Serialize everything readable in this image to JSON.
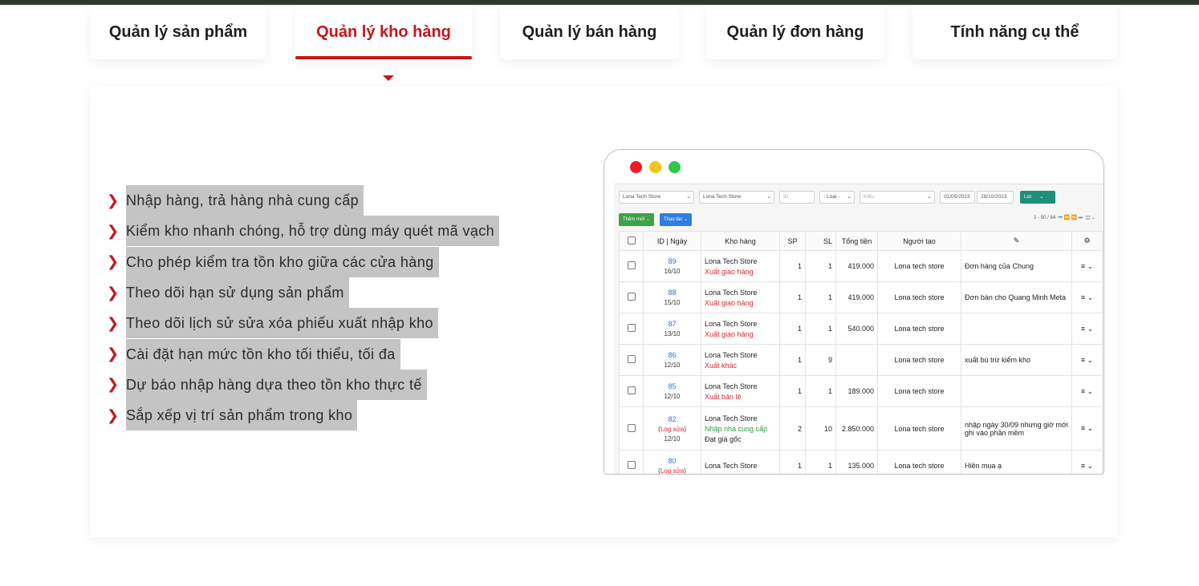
{
  "tabs": [
    {
      "label": "Quản lý sản phẩm",
      "active": false
    },
    {
      "label": "Quản lý kho hàng",
      "active": true
    },
    {
      "label": "Quản lý bán hàng",
      "active": false
    },
    {
      "label": "Quản lý đơn hàng",
      "active": false
    },
    {
      "label": "Tính năng cụ thể",
      "active": false
    }
  ],
  "features": [
    "Nhập hàng, trả hàng nhà cung cấp",
    "Kiểm kho nhanh chóng, hỗ trợ dùng máy quét mã vạch",
    "Cho phép kiểm tra tồn kho giữa các cửa hàng",
    "Theo dõi hạn sử dụng sản phẩm",
    "Theo dõi lịch sử sửa xóa phiếu xuất nhập kho",
    "Cài đặt hạn mức tồn kho tối thiểu, tối đa",
    "Dự báo nhập hàng dựa theo tồn kho thực tế",
    "Sắp xếp vị trí sản phẩm trong kho"
  ],
  "colors": {
    "accent": "#c5161d",
    "highlight": "#c4c4c4"
  },
  "mock": {
    "filters": {
      "store1": "Lona Tech Store",
      "store2": "Lona Tech Store",
      "id_placeholder": "ID",
      "type": "- Loại -",
      "kind_placeholder": "Kiểu",
      "date_from": "01/05/2023",
      "date_to": "28/10/2023",
      "filter_button": "Lọc"
    },
    "add_button": "Thêm mới",
    "action_button": "Thao tác",
    "pager": "1 - 50 / 84",
    "columns": [
      "ID | Ngày",
      "Kho hàng",
      "SP",
      "SL",
      "Tổng tiền",
      "Người tạo",
      "",
      ""
    ],
    "rows": [
      {
        "id": "89",
        "log": "",
        "date": "16/10",
        "store": "Lona Tech Store",
        "type": "Xuất giao hàng",
        "type_color": "red",
        "extra": "",
        "sp": "1",
        "sl": "1",
        "total": "419.000",
        "creator": "Lona tech store",
        "note": "Đơn hàng của Chung"
      },
      {
        "id": "88",
        "log": "",
        "date": "15/10",
        "store": "Lona Tech Store",
        "type": "Xuất giao hàng",
        "type_color": "red",
        "extra": "",
        "sp": "1",
        "sl": "1",
        "total": "419.000",
        "creator": "Lona tech store",
        "note": "Đơn bán cho Quang Minh Meta"
      },
      {
        "id": "87",
        "log": "",
        "date": "13/10",
        "store": "Lona Tech Store",
        "type": "Xuất giao hàng",
        "type_color": "red",
        "extra": "",
        "sp": "1",
        "sl": "1",
        "total": "540.000",
        "creator": "Lona tech store",
        "note": ""
      },
      {
        "id": "86",
        "log": "",
        "date": "12/10",
        "store": "Lona Tech Store",
        "type": "Xuất khác",
        "type_color": "red",
        "extra": "",
        "sp": "1",
        "sl": "9",
        "total": "",
        "creator": "Lona tech store",
        "note": "xuất bù trừ kiểm kho"
      },
      {
        "id": "85",
        "log": "",
        "date": "12/10",
        "store": "Lona Tech Store",
        "type": "Xuất bán lẻ",
        "type_color": "red",
        "extra": "",
        "sp": "1",
        "sl": "1",
        "total": "189.000",
        "creator": "Lona tech store",
        "note": ""
      },
      {
        "id": "82",
        "log": "Log sửa",
        "date": "12/10",
        "store": "Lona Tech Store",
        "type": "Nhập nhà cung cấp",
        "type_color": "green",
        "extra": "Đạt giá gốc",
        "sp": "2",
        "sl": "10",
        "total": "2.850.000",
        "creator": "Lona tech store",
        "note": "nhập ngày 30/09 nhưng giờ mới ghi vào phần mềm"
      },
      {
        "id": "80",
        "log": "Log sửa",
        "date": "",
        "store": "Lona Tech Store",
        "type": "",
        "type_color": "red",
        "extra": "",
        "sp": "1",
        "sl": "1",
        "total": "135.000",
        "creator": "Lona tech store",
        "note": "Hiền mua ạ"
      }
    ]
  }
}
